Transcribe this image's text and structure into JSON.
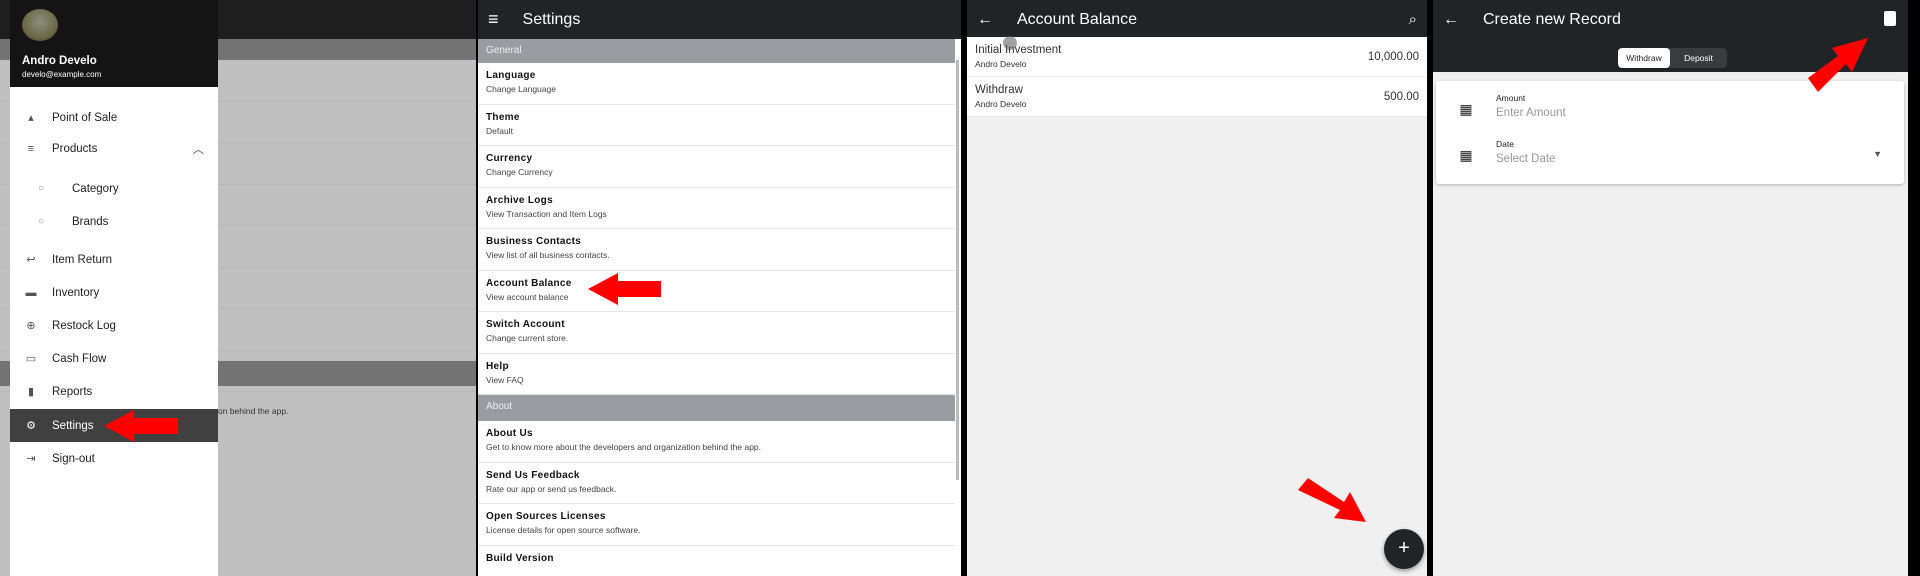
{
  "drawer": {
    "user_name": "Andro Develo",
    "user_email": "develo@example.com",
    "items": [
      {
        "label": "Point of Sale",
        "icon": "basket-icon"
      },
      {
        "label": "Products",
        "icon": "list-icon"
      },
      {
        "label": "Category",
        "icon": "circle-icon"
      },
      {
        "label": "Brands",
        "icon": "circle-icon"
      },
      {
        "label": "Item Return",
        "icon": "reply-icon"
      },
      {
        "label": "Inventory",
        "icon": "box-icon"
      },
      {
        "label": "Restock Log",
        "icon": "plus-circle-icon"
      },
      {
        "label": "Cash Flow",
        "icon": "card-icon"
      },
      {
        "label": "Reports",
        "icon": "bar-chart-icon"
      },
      {
        "label": "Settings",
        "icon": "gear-icon"
      },
      {
        "label": "Sign-out",
        "icon": "signout-icon"
      }
    ],
    "background_text": "on behind the app."
  },
  "settings": {
    "title": "Settings",
    "general_header": "General",
    "general": [
      {
        "title": "Language",
        "sub": "Change Language"
      },
      {
        "title": "Theme",
        "sub": "Default"
      },
      {
        "title": "Currency",
        "sub": "Change Currency"
      },
      {
        "title": "Archive Logs",
        "sub": "View Transaction and Item Logs"
      },
      {
        "title": "Business Contacts",
        "sub": "View list of all business contacts."
      },
      {
        "title": "Account Balance",
        "sub": "View account balance"
      },
      {
        "title": "Switch Account",
        "sub": "Change current store."
      },
      {
        "title": "Help",
        "sub": "View FAQ"
      }
    ],
    "about_header": "About",
    "about": [
      {
        "title": "About Us",
        "sub": "Get to know more about the developers and organization behind the app."
      },
      {
        "title": "Send Us Feedback",
        "sub": "Rate our app or send us feedback."
      },
      {
        "title": "Open Sources Licenses",
        "sub": "License details for open source software."
      },
      {
        "title": "Build Version",
        "sub": ""
      }
    ]
  },
  "balance": {
    "title": "Account Balance",
    "fab": "+",
    "rows": [
      {
        "name": "Initial Investment",
        "by": "Andro Develo",
        "amount": "10,000.00"
      },
      {
        "name": "Withdraw",
        "by": "Andro Develo",
        "amount": "500.00"
      }
    ]
  },
  "record": {
    "title": "Create new Record",
    "tabs": [
      "Withdraw",
      "Deposit"
    ],
    "active_tab": "Withdraw",
    "amount_label": "Amount",
    "amount_placeholder": "Enter Amount",
    "date_label": "Date",
    "date_placeholder": "Select Date"
  },
  "colors": {
    "appbar": "#222326",
    "arrow": "#ff0000",
    "section": "#9a9ca1"
  }
}
